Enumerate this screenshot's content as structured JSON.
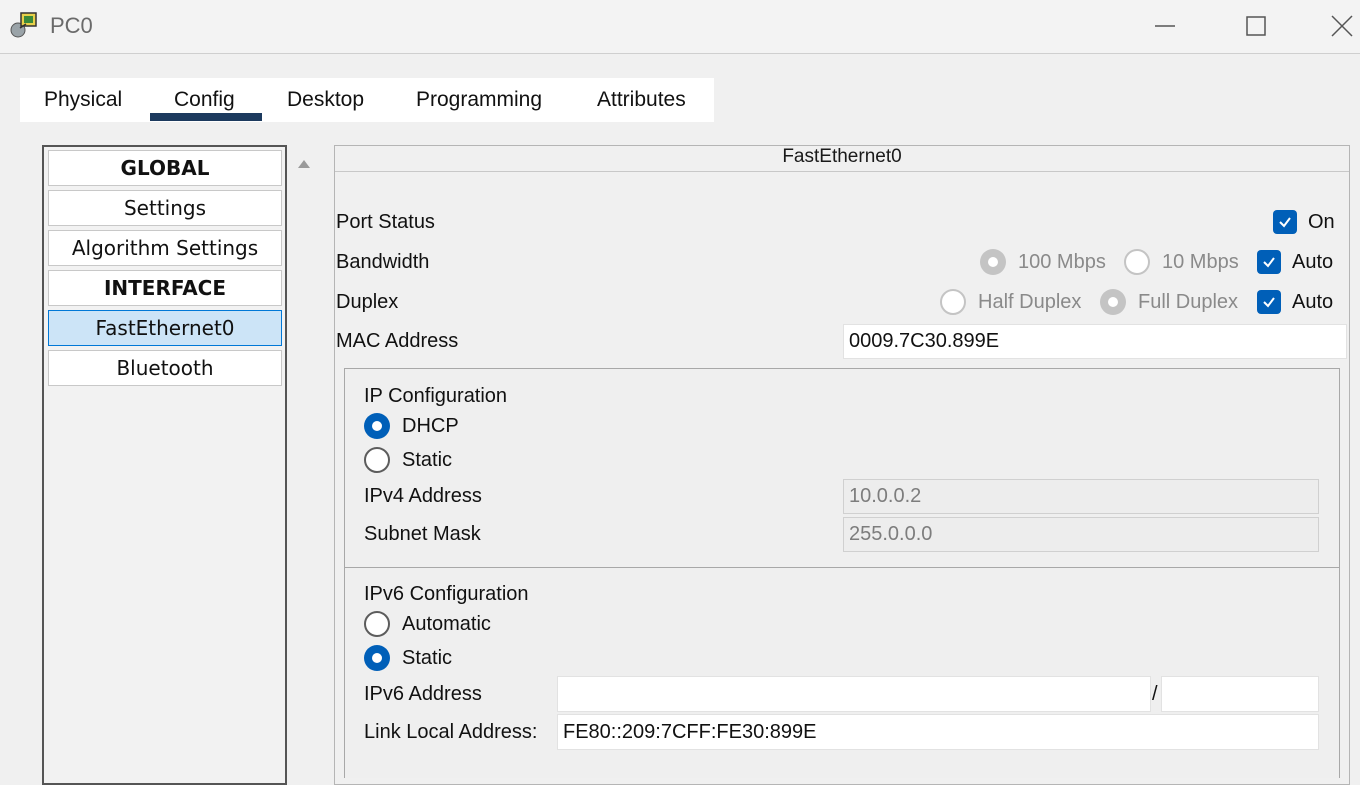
{
  "window": {
    "title": "PC0"
  },
  "tabs": [
    {
      "label": "Physical"
    },
    {
      "label": "Config"
    },
    {
      "label": "Desktop"
    },
    {
      "label": "Programming"
    },
    {
      "label": "Attributes"
    }
  ],
  "active_tab": "Config",
  "sidebar": {
    "items": [
      {
        "label": "GLOBAL",
        "type": "header"
      },
      {
        "label": "Settings",
        "type": "item"
      },
      {
        "label": "Algorithm Settings",
        "type": "item"
      },
      {
        "label": "INTERFACE",
        "type": "header"
      },
      {
        "label": "FastEthernet0",
        "type": "item",
        "selected": true
      },
      {
        "label": "Bluetooth",
        "type": "item"
      }
    ]
  },
  "panel": {
    "title": "FastEthernet0",
    "port_status": {
      "label": "Port Status",
      "on_label": "On",
      "checked": true
    },
    "bandwidth": {
      "label": "Bandwidth",
      "opt1": "100 Mbps",
      "opt2": "10 Mbps",
      "auto_label": "Auto",
      "auto_checked": true
    },
    "duplex": {
      "label": "Duplex",
      "opt1": "Half Duplex",
      "opt2": "Full Duplex",
      "auto_label": "Auto",
      "auto_checked": true
    },
    "mac": {
      "label": "MAC Address",
      "value": "0009.7C30.899E"
    },
    "ipv4": {
      "title": "IP Configuration",
      "dhcp_label": "DHCP",
      "static_label": "Static",
      "selected": "DHCP",
      "address_label": "IPv4 Address",
      "address_value": "10.0.0.2",
      "mask_label": "Subnet Mask",
      "mask_value": "255.0.0.0"
    },
    "ipv6": {
      "title": "IPv6 Configuration",
      "auto_label": "Automatic",
      "static_label": "Static",
      "selected": "Static",
      "address_label": "IPv6 Address",
      "address_value": "",
      "prefix_separator": "/",
      "prefix_value": "",
      "link_local_label": "Link Local Address:",
      "link_local_value": "FE80::209:7CFF:FE30:899E"
    }
  },
  "colors": {
    "accent": "#005fb8",
    "tab_underline": "#1c3a5e",
    "selected_item": "#cce4f7"
  }
}
